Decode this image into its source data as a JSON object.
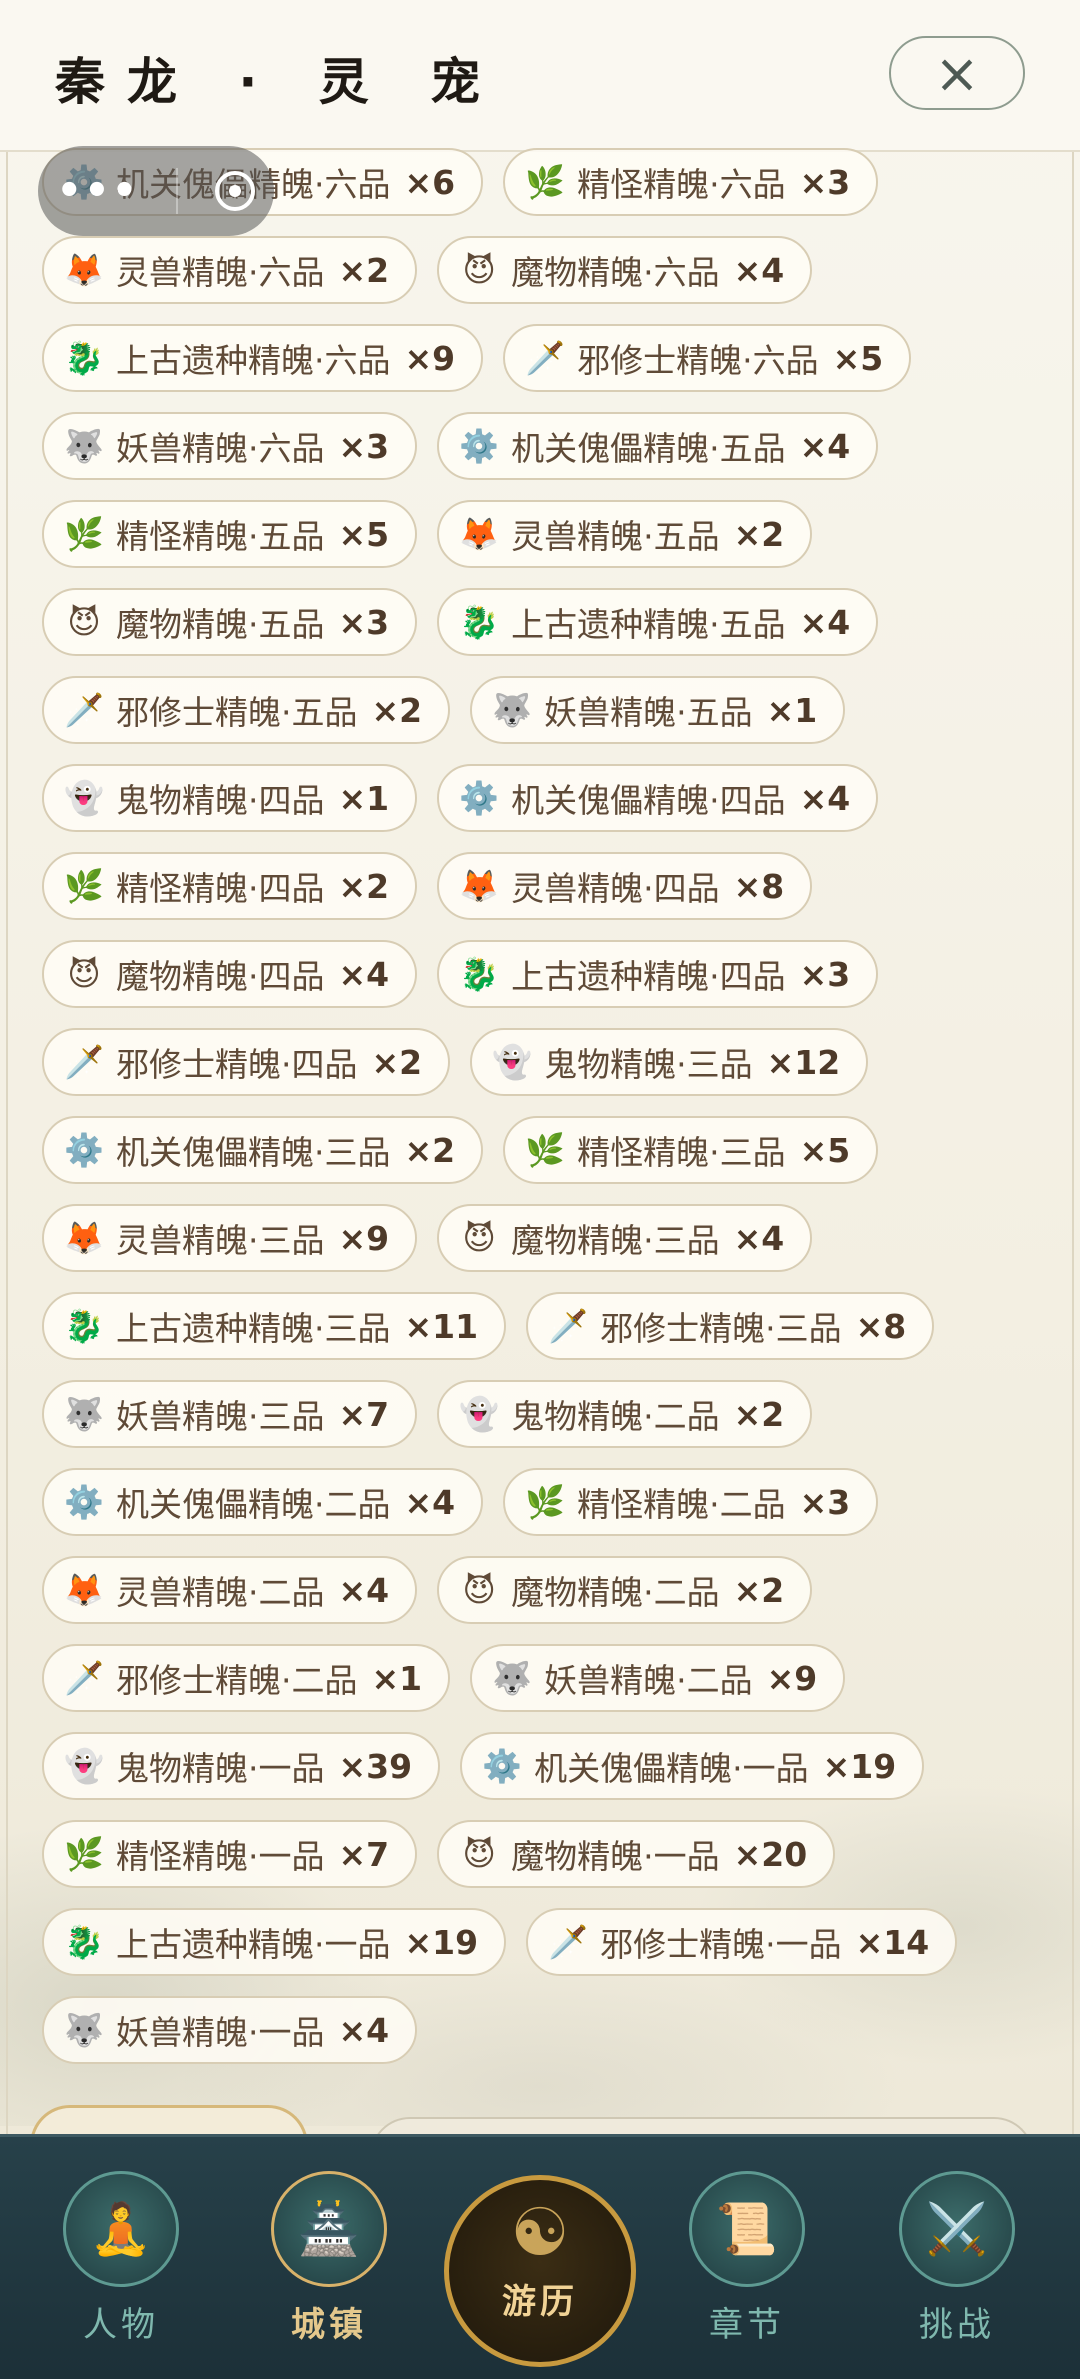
{
  "header": {
    "title": "秦龙 · 灵 宠",
    "close_icon": "×"
  },
  "capsule": {
    "more": "•••",
    "close": "record-circle-icon"
  },
  "items": [
    {
      "icon": "⚙️",
      "icon_name": "gear-icon",
      "name": "机关傀儡精魄·六品",
      "count": "×6"
    },
    {
      "icon": "🌿",
      "icon_name": "herb-icon",
      "name": "精怪精魄·六品",
      "count": "×3"
    },
    {
      "icon": "🦊",
      "icon_name": "fox-icon",
      "name": "灵兽精魄·六品",
      "count": "×2"
    },
    {
      "icon": "😈",
      "icon_name": "demon-icon",
      "name": "魔物精魄·六品",
      "count": "×4"
    },
    {
      "icon": "🐉",
      "icon_name": "dragon-icon",
      "name": "上古遗种精魄·六品",
      "count": "×9"
    },
    {
      "icon": "🗡️",
      "icon_name": "dagger-icon",
      "name": "邪修士精魄·六品",
      "count": "×5"
    },
    {
      "icon": "🐺",
      "icon_name": "wolf-icon",
      "name": "妖兽精魄·六品",
      "count": "×3"
    },
    {
      "icon": "⚙️",
      "icon_name": "gear-icon",
      "name": "机关傀儡精魄·五品",
      "count": "×4"
    },
    {
      "icon": "🌿",
      "icon_name": "herb-icon",
      "name": "精怪精魄·五品",
      "count": "×5"
    },
    {
      "icon": "🦊",
      "icon_name": "fox-icon",
      "name": "灵兽精魄·五品",
      "count": "×2"
    },
    {
      "icon": "😈",
      "icon_name": "demon-icon",
      "name": "魔物精魄·五品",
      "count": "×3"
    },
    {
      "icon": "🐉",
      "icon_name": "dragon-icon",
      "name": "上古遗种精魄·五品",
      "count": "×4"
    },
    {
      "icon": "🗡️",
      "icon_name": "dagger-icon",
      "name": "邪修士精魄·五品",
      "count": "×2"
    },
    {
      "icon": "🐺",
      "icon_name": "wolf-icon",
      "name": "妖兽精魄·五品",
      "count": "×1"
    },
    {
      "icon": "👻",
      "icon_name": "ghost-icon",
      "name": "鬼物精魄·四品",
      "count": "×1"
    },
    {
      "icon": "⚙️",
      "icon_name": "gear-icon",
      "name": "机关傀儡精魄·四品",
      "count": "×4"
    },
    {
      "icon": "🌿",
      "icon_name": "herb-icon",
      "name": "精怪精魄·四品",
      "count": "×2"
    },
    {
      "icon": "🦊",
      "icon_name": "fox-icon",
      "name": "灵兽精魄·四品",
      "count": "×8"
    },
    {
      "icon": "😈",
      "icon_name": "demon-icon",
      "name": "魔物精魄·四品",
      "count": "×4"
    },
    {
      "icon": "🐉",
      "icon_name": "dragon-icon",
      "name": "上古遗种精魄·四品",
      "count": "×3"
    },
    {
      "icon": "🗡️",
      "icon_name": "dagger-icon",
      "name": "邪修士精魄·四品",
      "count": "×2"
    },
    {
      "icon": "👻",
      "icon_name": "ghost-icon",
      "name": "鬼物精魄·三品",
      "count": "×12"
    },
    {
      "icon": "⚙️",
      "icon_name": "gear-icon",
      "name": "机关傀儡精魄·三品",
      "count": "×2"
    },
    {
      "icon": "🌿",
      "icon_name": "herb-icon",
      "name": "精怪精魄·三品",
      "count": "×5"
    },
    {
      "icon": "🦊",
      "icon_name": "fox-icon",
      "name": "灵兽精魄·三品",
      "count": "×9"
    },
    {
      "icon": "😈",
      "icon_name": "demon-icon",
      "name": "魔物精魄·三品",
      "count": "×4"
    },
    {
      "icon": "🐉",
      "icon_name": "dragon-icon",
      "name": "上古遗种精魄·三品",
      "count": "×11"
    },
    {
      "icon": "🗡️",
      "icon_name": "dagger-icon",
      "name": "邪修士精魄·三品",
      "count": "×8"
    },
    {
      "icon": "🐺",
      "icon_name": "wolf-icon",
      "name": "妖兽精魄·三品",
      "count": "×7"
    },
    {
      "icon": "👻",
      "icon_name": "ghost-icon",
      "name": "鬼物精魄·二品",
      "count": "×2"
    },
    {
      "icon": "⚙️",
      "icon_name": "gear-icon",
      "name": "机关傀儡精魄·二品",
      "count": "×4"
    },
    {
      "icon": "🌿",
      "icon_name": "herb-icon",
      "name": "精怪精魄·二品",
      "count": "×3"
    },
    {
      "icon": "🦊",
      "icon_name": "fox-icon",
      "name": "灵兽精魄·二品",
      "count": "×4"
    },
    {
      "icon": "😈",
      "icon_name": "demon-icon",
      "name": "魔物精魄·二品",
      "count": "×2"
    },
    {
      "icon": "🗡️",
      "icon_name": "dagger-icon",
      "name": "邪修士精魄·二品",
      "count": "×1"
    },
    {
      "icon": "🐺",
      "icon_name": "wolf-icon",
      "name": "妖兽精魄·二品",
      "count": "×9"
    },
    {
      "icon": "👻",
      "icon_name": "ghost-icon",
      "name": "鬼物精魄·一品",
      "count": "×39"
    },
    {
      "icon": "⚙️",
      "icon_name": "gear-icon",
      "name": "机关傀儡精魄·一品",
      "count": "×19"
    },
    {
      "icon": "🌿",
      "icon_name": "herb-icon",
      "name": "精怪精魄·一品",
      "count": "×7"
    },
    {
      "icon": "😈",
      "icon_name": "demon-icon",
      "name": "魔物精魄·一品",
      "count": "×20"
    },
    {
      "icon": "🐉",
      "icon_name": "dragon-icon",
      "name": "上古遗种精魄·一品",
      "count": "×19"
    },
    {
      "icon": "🗡️",
      "icon_name": "dagger-icon",
      "name": "邪修士精魄·一品",
      "count": "×14"
    },
    {
      "icon": "🐺",
      "icon_name": "wolf-icon",
      "name": "妖兽精魄·一品",
      "count": "×4"
    }
  ],
  "nav": {
    "items": [
      {
        "label": "人物",
        "icon": "🧘",
        "icon_name": "character-icon"
      },
      {
        "label": "城镇",
        "icon": "🏯",
        "icon_name": "town-icon",
        "active": true
      },
      {
        "label": "游历",
        "icon": "☯",
        "icon_name": "yin-yang-icon",
        "center": true
      },
      {
        "label": "章节",
        "icon": "📜",
        "icon_name": "scroll-icon"
      },
      {
        "label": "挑战",
        "icon": "⚔️",
        "icon_name": "sword-icon"
      }
    ]
  }
}
